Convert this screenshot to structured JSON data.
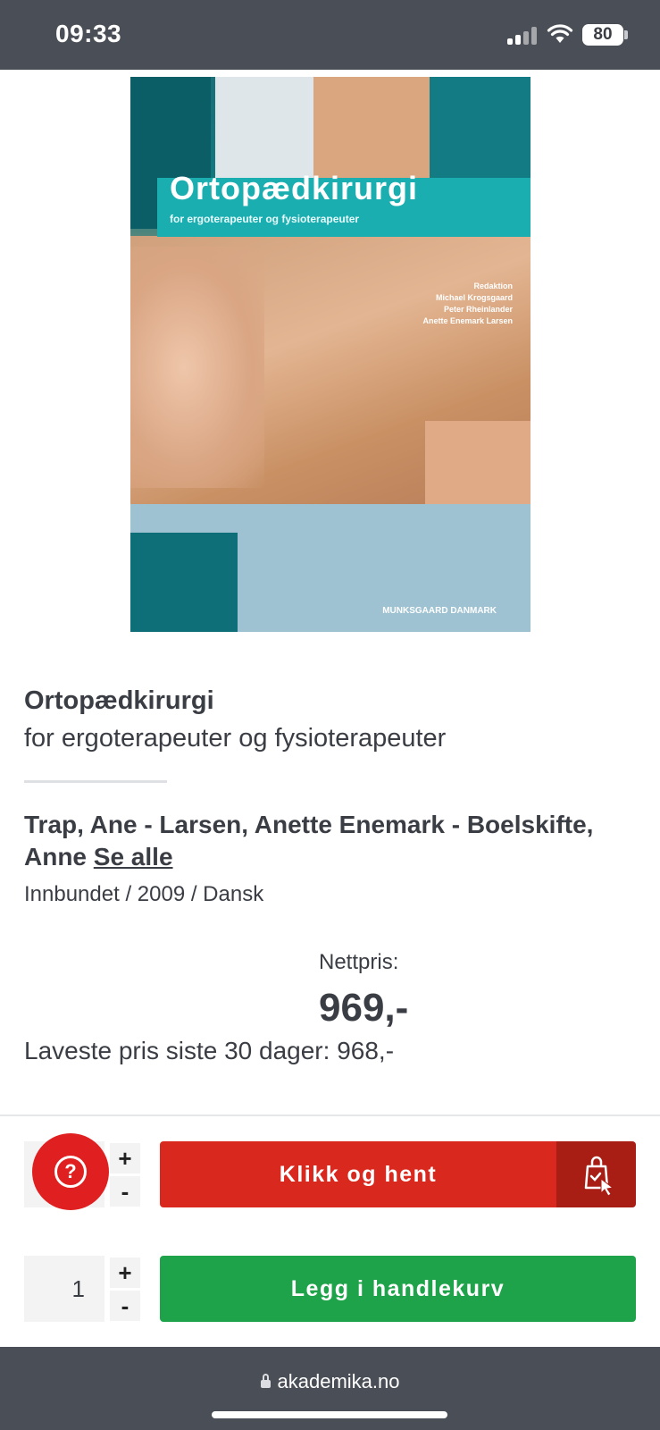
{
  "status_bar": {
    "time": "09:33",
    "battery": "80"
  },
  "cover": {
    "title": "Ortopædkirurgi",
    "subtitle": "for ergoterapeuter og fysioterapeuter",
    "editors": [
      "Redaktion",
      "Michael Krogsgaard",
      "Peter Rheinlander",
      "Anette Enemark Larsen"
    ],
    "publisher": "MUNKSGAARD DANMARK"
  },
  "product": {
    "title": "Ortopædkirurgi",
    "subtitle": "for ergoterapeuter og fysioterapeuter",
    "authors": "Trap, Ane - Larsen, Anette Enemark - Boelskifte, Anne",
    "see_all": "Se alle",
    "meta": "Innbundet / 2009 / Dansk",
    "price_label": "Nettpris:",
    "price": "969,-",
    "lowest_price": "Laveste pris siste 30 dager: 968,-"
  },
  "actions": {
    "help_icon": "?",
    "plus": "+",
    "minus": "-",
    "click_collect_label": "Klikk og hent",
    "quantity": "1",
    "add_to_cart_label": "Legg i handlekurv"
  },
  "browser": {
    "url": "akademika.no"
  },
  "colors": {
    "red": "#d9291e",
    "dark_red": "#a81d14",
    "green": "#1ea34a",
    "bar": "#4a4e56"
  }
}
